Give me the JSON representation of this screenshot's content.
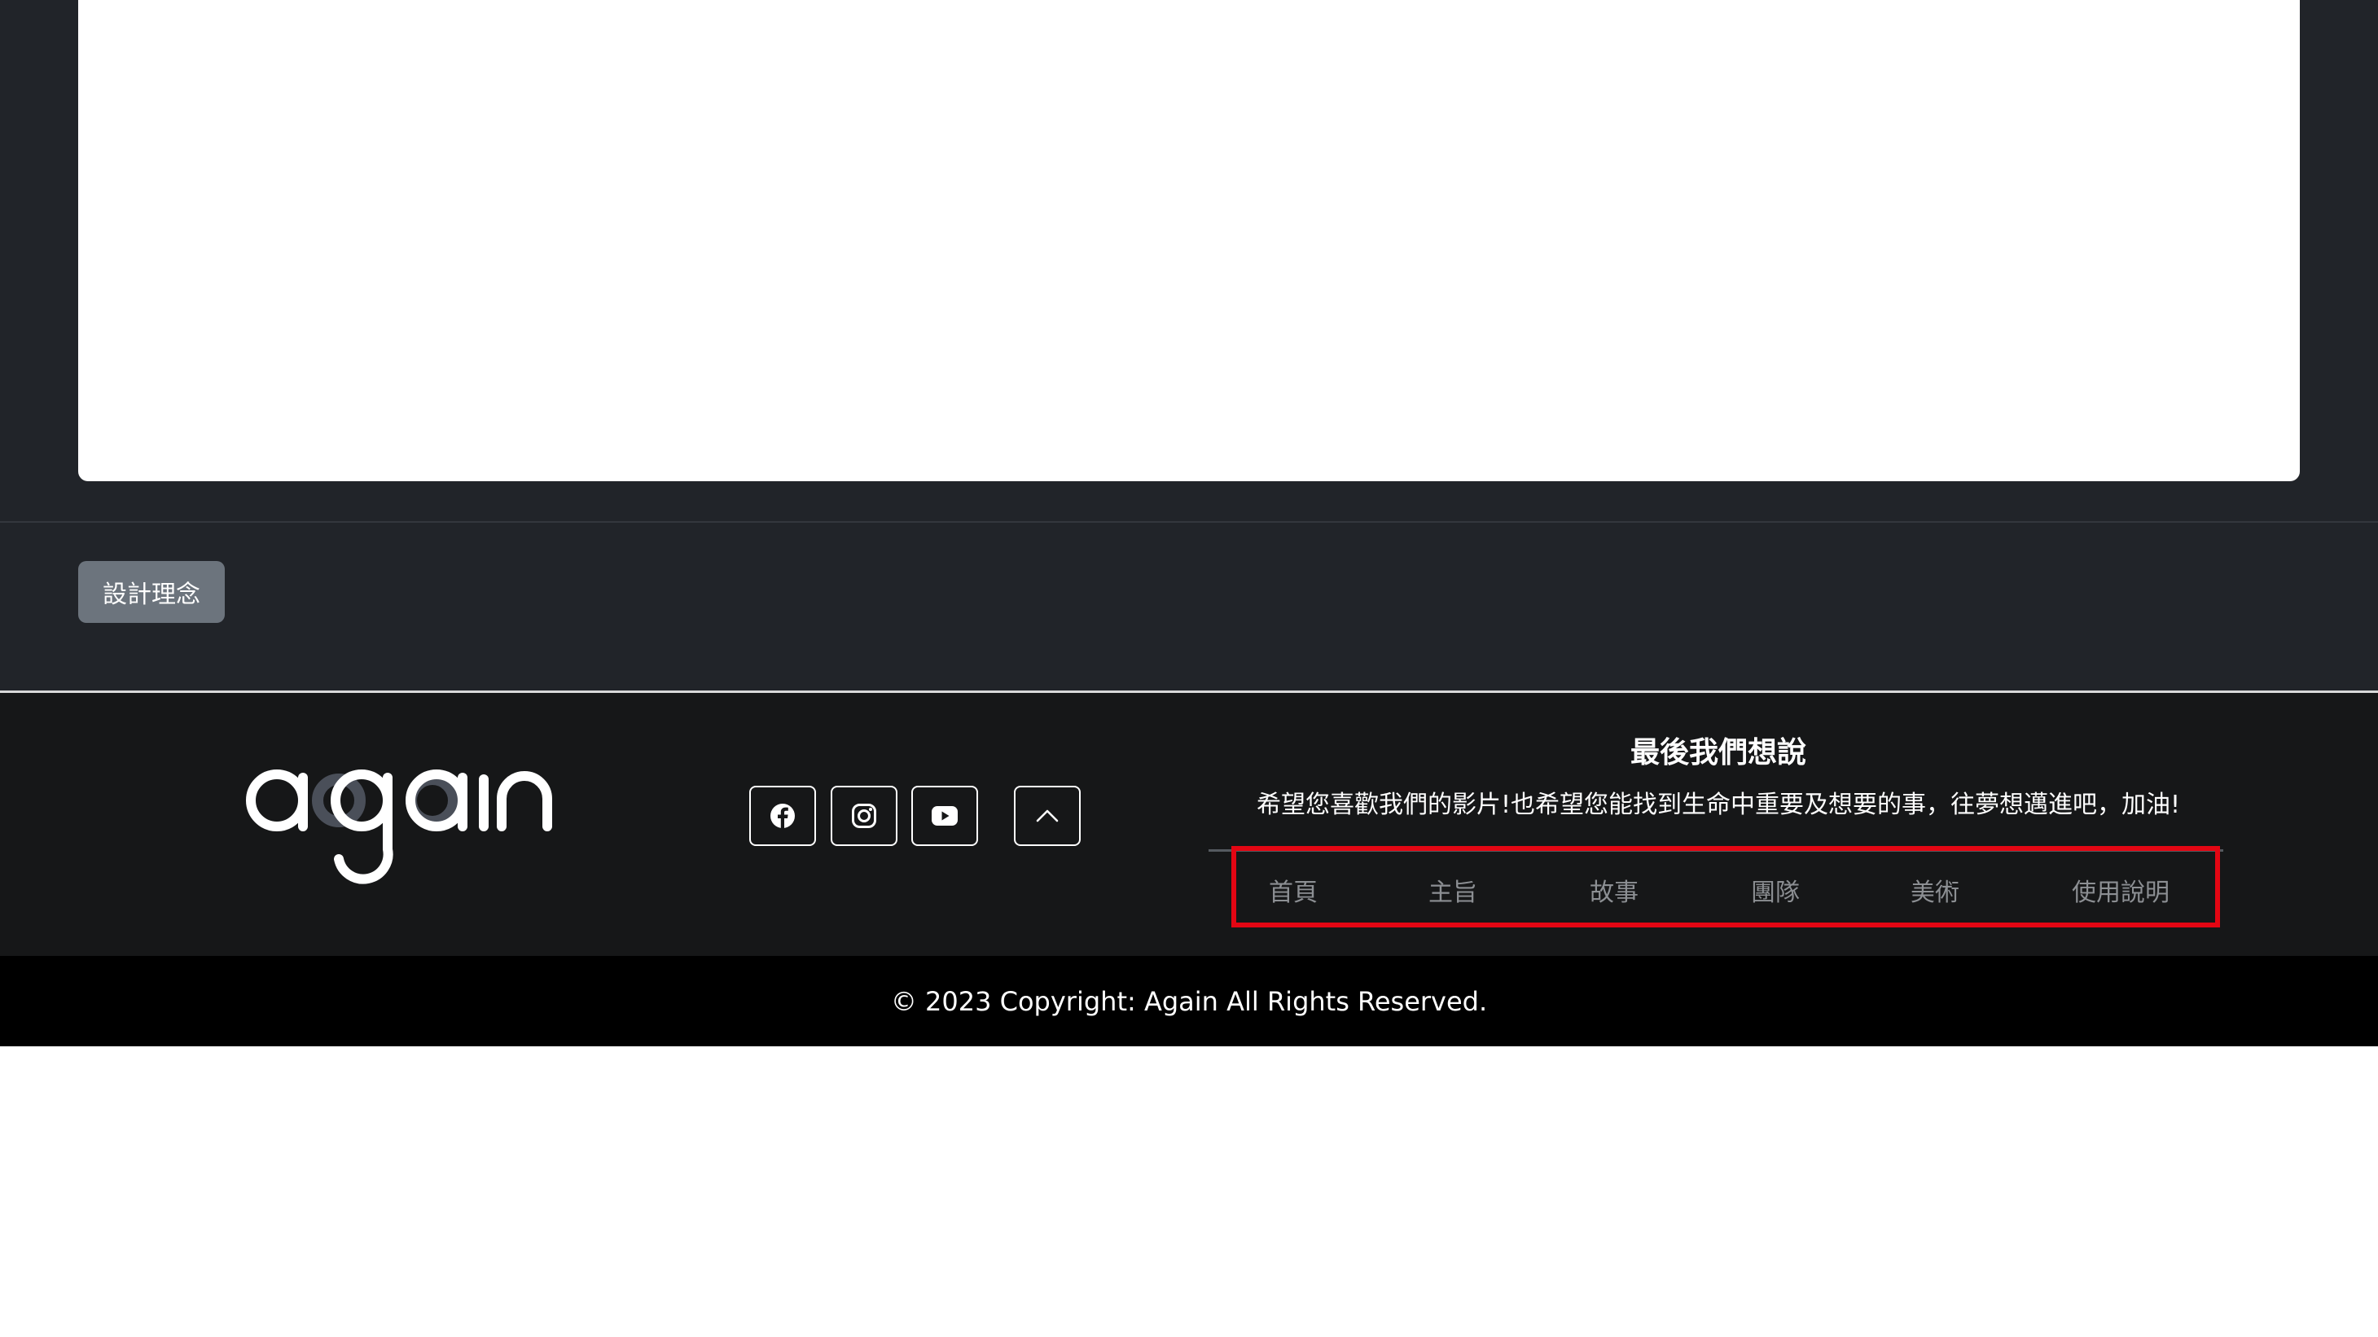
{
  "main": {
    "design_button_label": "設計理念"
  },
  "footer": {
    "logo_text": "again",
    "social": [
      {
        "icon": "facebook-icon"
      },
      {
        "icon": "instagram-icon"
      },
      {
        "icon": "youtube-icon"
      }
    ],
    "back_to_top_icon": "chevron-up-icon",
    "title": "最後我們想說",
    "message": "希望您喜歡我們的影片!也希望您能找到生命中重要及想要的事，往夢想邁進吧，加油!",
    "nav": [
      "首頁",
      "主旨",
      "故事",
      "團隊",
      "美術",
      "使用說明"
    ],
    "highlight_color": "#e30613"
  },
  "copyright": "© 2023 Copyright: Again All Rights Reserved."
}
